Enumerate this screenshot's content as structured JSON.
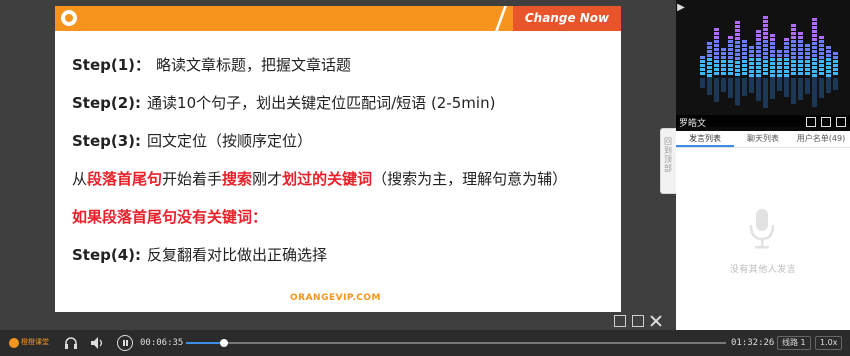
{
  "slide": {
    "header_badge": "Change Now",
    "lines": [
      {
        "step": "Step(1)：",
        "text": "略读文章标题，把握文章话题"
      },
      {
        "step": "Step(2):",
        "text": "通读10个句子，划出关键定位匹配词/短语 (2-5min)"
      },
      {
        "step": "Step(3):",
        "text": "回文定位（按顺序定位）"
      }
    ],
    "line4": {
      "p1": "从",
      "h1": "段落首尾句",
      "p2": "开始着手",
      "h2": "搜索",
      "p3": "刚才",
      "h3": "划过的关键词",
      "p4": "（搜索为主，理解句意为辅）"
    },
    "line5": "如果段落首尾句没有关键词：",
    "line6": {
      "step": "Step(4):",
      "text": "反复翻看对比做出正确选择"
    },
    "footer_brand": "ORANGEVIP.COM"
  },
  "camera": {
    "teacher_name": "罗皓文"
  },
  "chat": {
    "tabs": [
      "发言列表",
      "聊天列表",
      "用户名单(49)"
    ],
    "active_tab": 0,
    "empty_text": "没有其他人发言"
  },
  "side_tab_label": "回到顶部",
  "player": {
    "logo_text": "橙橙课堂",
    "current_time": "00:06:35",
    "total_time": "01:32:26",
    "progress": 0.071,
    "route_label": "线路 1",
    "speed_label": "1.0x"
  },
  "colors": {
    "accent_orange": "#f7941d",
    "badge_red": "#e8552b",
    "highlight_red": "#e8202a",
    "progress_blue": "#3a8ee6"
  }
}
